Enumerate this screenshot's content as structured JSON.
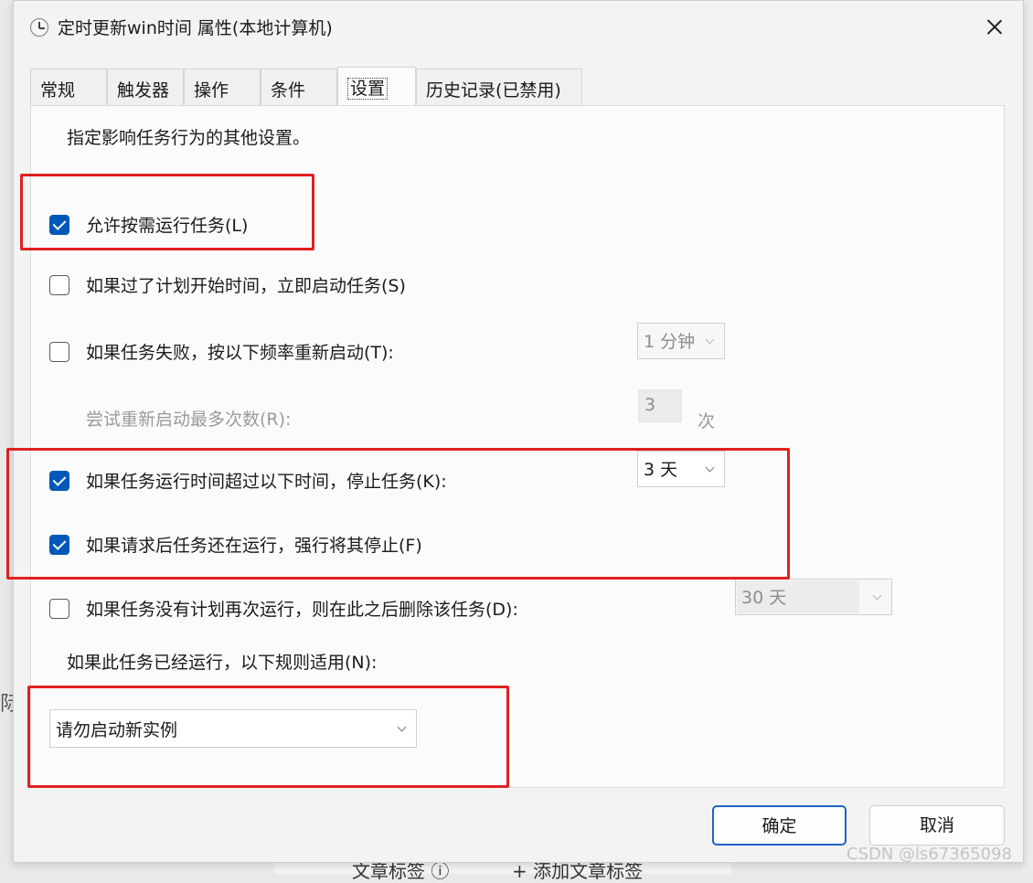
{
  "dialog": {
    "title": "定时更新win时间 属性(本地计算机)",
    "tabs": [
      {
        "label": "常规"
      },
      {
        "label": "触发器"
      },
      {
        "label": "操作"
      },
      {
        "label": "条件"
      },
      {
        "label": "设置",
        "active": true
      },
      {
        "label": "历史记录(已禁用)"
      }
    ],
    "intro": "指定影响任务行为的其他设置。",
    "options": [
      {
        "label": "允许按需运行任务(L)",
        "checked": true
      },
      {
        "label": "如果过了计划开始时间，立即启动任务(S)",
        "checked": false
      },
      {
        "label": "如果任务失败，按以下频率重新启动(T):",
        "checked": false
      },
      {
        "label": "尝试重新启动最多次数(R):",
        "disabled": true
      },
      {
        "label": "如果任务运行时间超过以下时间，停止任务(K):",
        "checked": true
      },
      {
        "label": "如果请求后任务还在运行，强行将其停止(F)",
        "checked": true
      },
      {
        "label": "如果任务没有计划再次运行，则在此之后删除该任务(D):",
        "checked": false
      }
    ],
    "restart_interval": "1 分钟",
    "restart_count": "3",
    "restart_count_unit": "次",
    "stop_after": "3 天",
    "delete_after": "30 天",
    "rule_label": "如果此任务已经运行，以下规则适用(N):",
    "rule_value": "请勿启动新实例",
    "ok_label": "确定",
    "cancel_label": "取消"
  },
  "background": {
    "left_fragment": "际",
    "bottom_text_1": "文章标签 ⓘ",
    "bottom_text_2": "+ 添加文章标签"
  },
  "watermark": "CSDN @ls67365098",
  "colors": {
    "checkbox_checked": "#0058b8",
    "highlight_box": "#e02020",
    "primary_button_border": "#1e63c4"
  }
}
